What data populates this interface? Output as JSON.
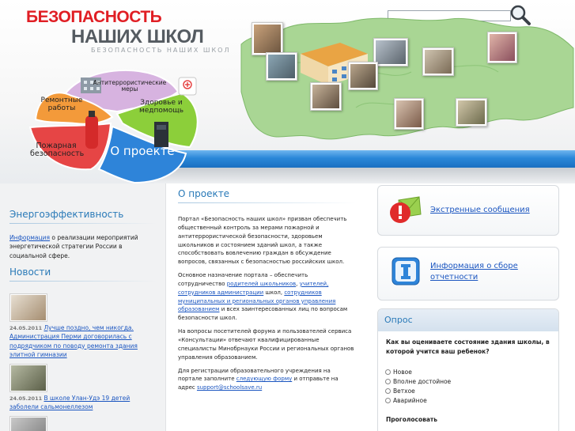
{
  "logo": {
    "line1": "БЕЗОПАСНОСТЬ",
    "line2": "НАШИХ ШКОЛ",
    "tagline": "БЕЗОПАСНОСТЬ НАШИХ ШКОЛ"
  },
  "search": {
    "placeholder": ""
  },
  "flower_menu": {
    "antiterror": "Антитеррористические меры",
    "repairs": "Ремонтные работы",
    "health": "Здоровье и медпомощь",
    "fire": "Пожарная безопасность",
    "about": "О проекте"
  },
  "left": {
    "energy_title": "Энергоэффективность",
    "energy_link": "Информация",
    "energy_text": " о реализации мероприятий энергетической стратегии России в социальной сфере.",
    "news_title": "Новости",
    "news": [
      {
        "date": "24.05.2011",
        "text": "Лучше поздно, чем никогда. Администрация Перми договорилась с подрядчиком по поводу ремонта здания элитной гимназии"
      },
      {
        "date": "24.05.2011",
        "text": "В школе Улан-Удэ 19 детей заболели сальмонеллезом"
      }
    ]
  },
  "center": {
    "title": "О проекте",
    "p1": "Портал «Безопасность наших школ» призван обеспечить общественный контроль за мерами пожарной и антитеррористической безопасности, здоровьем школьников и состоянием зданий школ, а также способствовать вовлечению граждан в обсуждение вопросов, связанных с безопасностью российских школ.",
    "p2_a": "Основное назначение портала – обеспечить сотрудничество ",
    "p2_link1": "родителей школьников",
    "p2_b": ", ",
    "p2_link2": "учителей, сотрудников администрации",
    "p2_c": " школ, ",
    "p2_link3": "сотрудников муниципальных и региональных органов управления образованием",
    "p2_d": " и всех заинтересованных лиц по вопросам безопасности школ.",
    "p3": "На вопросы посетителей форума и пользователей сервиса «Консультации» отвечают квалифицированные специалисты Минобрнауки России и региональных органов управления образованием.",
    "p4_a": "Для регистрации образовательного учреждения на портале заполните ",
    "p4_link": "следующую форму",
    "p4_b": " и отправьте на адрес ",
    "p4_email": "support@schoolsave.ru"
  },
  "right": {
    "emergency_label": "Экстренные сообщения",
    "report_label": "Информация о сборе отчетности",
    "poll_title": "Опрос",
    "poll_question": "Как вы оцениваете состояние здания школы, в которой учится ваш ребенок?",
    "poll_options": [
      "Новое",
      "Вполне достойное",
      "Ветхое",
      "Аварийное"
    ],
    "poll_vote": "Проголосовать"
  },
  "colors": {
    "brand_red": "#e01e24",
    "link_blue": "#1a55c0",
    "heading_blue": "#2a7ab8",
    "bar_blue": "#2a87d8"
  }
}
